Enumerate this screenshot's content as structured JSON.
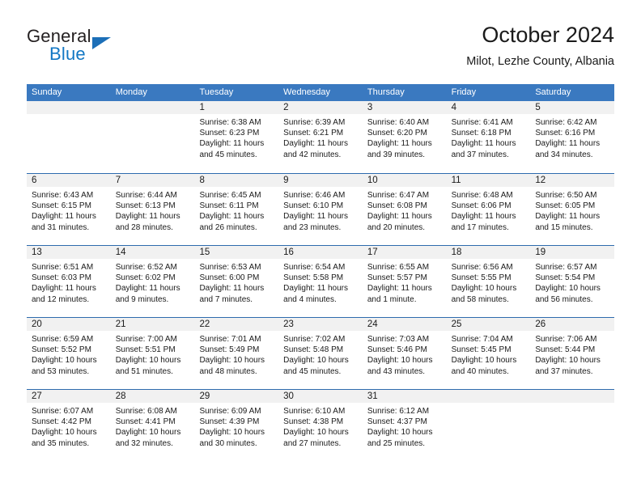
{
  "brand": {
    "name_part1": "General",
    "name_part2": "Blue",
    "triangle_icon": "triangle-icon"
  },
  "header": {
    "title": "October 2024",
    "subtitle": "Milot, Lezhe County, Albania"
  },
  "colors": {
    "header_blue": "#3a79c0",
    "row_separator_blue": "#2e6bae",
    "day_band_gray": "#f1f1f1",
    "brand_blue": "#1277c4",
    "text": "#1a1a1a"
  },
  "weekdays": [
    "Sunday",
    "Monday",
    "Tuesday",
    "Wednesday",
    "Thursday",
    "Friday",
    "Saturday"
  ],
  "weeks": [
    [
      {
        "day": "",
        "lines": []
      },
      {
        "day": "",
        "lines": []
      },
      {
        "day": "1",
        "lines": [
          "Sunrise: 6:38 AM",
          "Sunset: 6:23 PM",
          "Daylight: 11 hours and 45 minutes."
        ]
      },
      {
        "day": "2",
        "lines": [
          "Sunrise: 6:39 AM",
          "Sunset: 6:21 PM",
          "Daylight: 11 hours and 42 minutes."
        ]
      },
      {
        "day": "3",
        "lines": [
          "Sunrise: 6:40 AM",
          "Sunset: 6:20 PM",
          "Daylight: 11 hours and 39 minutes."
        ]
      },
      {
        "day": "4",
        "lines": [
          "Sunrise: 6:41 AM",
          "Sunset: 6:18 PM",
          "Daylight: 11 hours and 37 minutes."
        ]
      },
      {
        "day": "5",
        "lines": [
          "Sunrise: 6:42 AM",
          "Sunset: 6:16 PM",
          "Daylight: 11 hours and 34 minutes."
        ]
      }
    ],
    [
      {
        "day": "6",
        "lines": [
          "Sunrise: 6:43 AM",
          "Sunset: 6:15 PM",
          "Daylight: 11 hours and 31 minutes."
        ]
      },
      {
        "day": "7",
        "lines": [
          "Sunrise: 6:44 AM",
          "Sunset: 6:13 PM",
          "Daylight: 11 hours and 28 minutes."
        ]
      },
      {
        "day": "8",
        "lines": [
          "Sunrise: 6:45 AM",
          "Sunset: 6:11 PM",
          "Daylight: 11 hours and 26 minutes."
        ]
      },
      {
        "day": "9",
        "lines": [
          "Sunrise: 6:46 AM",
          "Sunset: 6:10 PM",
          "Daylight: 11 hours and 23 minutes."
        ]
      },
      {
        "day": "10",
        "lines": [
          "Sunrise: 6:47 AM",
          "Sunset: 6:08 PM",
          "Daylight: 11 hours and 20 minutes."
        ]
      },
      {
        "day": "11",
        "lines": [
          "Sunrise: 6:48 AM",
          "Sunset: 6:06 PM",
          "Daylight: 11 hours and 17 minutes."
        ]
      },
      {
        "day": "12",
        "lines": [
          "Sunrise: 6:50 AM",
          "Sunset: 6:05 PM",
          "Daylight: 11 hours and 15 minutes."
        ]
      }
    ],
    [
      {
        "day": "13",
        "lines": [
          "Sunrise: 6:51 AM",
          "Sunset: 6:03 PM",
          "Daylight: 11 hours and 12 minutes."
        ]
      },
      {
        "day": "14",
        "lines": [
          "Sunrise: 6:52 AM",
          "Sunset: 6:02 PM",
          "Daylight: 11 hours and 9 minutes."
        ]
      },
      {
        "day": "15",
        "lines": [
          "Sunrise: 6:53 AM",
          "Sunset: 6:00 PM",
          "Daylight: 11 hours and 7 minutes."
        ]
      },
      {
        "day": "16",
        "lines": [
          "Sunrise: 6:54 AM",
          "Sunset: 5:58 PM",
          "Daylight: 11 hours and 4 minutes."
        ]
      },
      {
        "day": "17",
        "lines": [
          "Sunrise: 6:55 AM",
          "Sunset: 5:57 PM",
          "Daylight: 11 hours and 1 minute."
        ]
      },
      {
        "day": "18",
        "lines": [
          "Sunrise: 6:56 AM",
          "Sunset: 5:55 PM",
          "Daylight: 10 hours and 58 minutes."
        ]
      },
      {
        "day": "19",
        "lines": [
          "Sunrise: 6:57 AM",
          "Sunset: 5:54 PM",
          "Daylight: 10 hours and 56 minutes."
        ]
      }
    ],
    [
      {
        "day": "20",
        "lines": [
          "Sunrise: 6:59 AM",
          "Sunset: 5:52 PM",
          "Daylight: 10 hours and 53 minutes."
        ]
      },
      {
        "day": "21",
        "lines": [
          "Sunrise: 7:00 AM",
          "Sunset: 5:51 PM",
          "Daylight: 10 hours and 51 minutes."
        ]
      },
      {
        "day": "22",
        "lines": [
          "Sunrise: 7:01 AM",
          "Sunset: 5:49 PM",
          "Daylight: 10 hours and 48 minutes."
        ]
      },
      {
        "day": "23",
        "lines": [
          "Sunrise: 7:02 AM",
          "Sunset: 5:48 PM",
          "Daylight: 10 hours and 45 minutes."
        ]
      },
      {
        "day": "24",
        "lines": [
          "Sunrise: 7:03 AM",
          "Sunset: 5:46 PM",
          "Daylight: 10 hours and 43 minutes."
        ]
      },
      {
        "day": "25",
        "lines": [
          "Sunrise: 7:04 AM",
          "Sunset: 5:45 PM",
          "Daylight: 10 hours and 40 minutes."
        ]
      },
      {
        "day": "26",
        "lines": [
          "Sunrise: 7:06 AM",
          "Sunset: 5:44 PM",
          "Daylight: 10 hours and 37 minutes."
        ]
      }
    ],
    [
      {
        "day": "27",
        "lines": [
          "Sunrise: 6:07 AM",
          "Sunset: 4:42 PM",
          "Daylight: 10 hours and 35 minutes."
        ]
      },
      {
        "day": "28",
        "lines": [
          "Sunrise: 6:08 AM",
          "Sunset: 4:41 PM",
          "Daylight: 10 hours and 32 minutes."
        ]
      },
      {
        "day": "29",
        "lines": [
          "Sunrise: 6:09 AM",
          "Sunset: 4:39 PM",
          "Daylight: 10 hours and 30 minutes."
        ]
      },
      {
        "day": "30",
        "lines": [
          "Sunrise: 6:10 AM",
          "Sunset: 4:38 PM",
          "Daylight: 10 hours and 27 minutes."
        ]
      },
      {
        "day": "31",
        "lines": [
          "Sunrise: 6:12 AM",
          "Sunset: 4:37 PM",
          "Daylight: 10 hours and 25 minutes."
        ]
      },
      {
        "day": "",
        "lines": []
      },
      {
        "day": "",
        "lines": []
      }
    ]
  ]
}
